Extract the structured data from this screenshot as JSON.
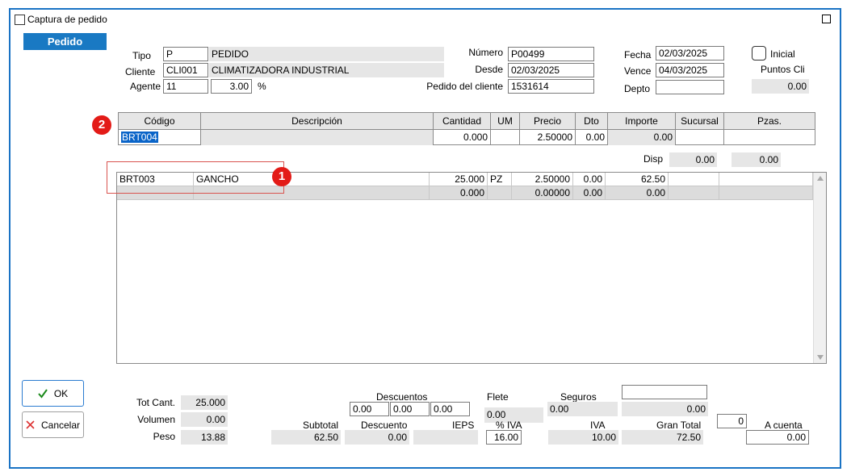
{
  "window": {
    "title": "Captura de pedido"
  },
  "tab": {
    "label": "Pedido"
  },
  "header": {
    "tipo_label": "Tipo",
    "tipo_code": "P",
    "tipo_desc": "PEDIDO",
    "cliente_label": "Cliente",
    "cliente_code": "CLI001",
    "cliente_name": "CLIMATIZADORA INDUSTRIAL",
    "agente_label": "Agente",
    "agente_code": "11",
    "agente_pct": "3.00",
    "pct_symbol": "%",
    "numero_label": "Número",
    "numero": "P00499",
    "desde_label": "Desde",
    "desde": "02/03/2025",
    "pedido_cliente_label": "Pedido del cliente",
    "pedido_cliente": "1531614",
    "fecha_label": "Fecha",
    "fecha": "02/03/2025",
    "vence_label": "Vence",
    "vence": "04/03/2025",
    "depto_label": "Depto",
    "depto": "",
    "inicial_label": "Inicial",
    "puntos_label": "Puntos Cli",
    "puntos": "0.00"
  },
  "entry_table": {
    "columns": [
      "Código",
      "Descripción",
      "Cantidad",
      "UM",
      "Precio",
      "Dto",
      "Importe",
      "Sucursal",
      "Pzas."
    ],
    "row": {
      "codigo": "BRT004",
      "descripcion": "",
      "cantidad": "0.000",
      "um": "",
      "precio": "2.50000",
      "dto": "0.00",
      "importe": "0.00",
      "sucursal": "",
      "pzas": ""
    }
  },
  "disp": {
    "label": "Disp",
    "value1": "0.00",
    "value2": "0.00"
  },
  "lines": [
    {
      "codigo": "BRT003",
      "descripcion": "GANCHO",
      "cantidad": "25.000",
      "um": "PZ",
      "precio": "2.50000",
      "dto": "0.00",
      "importe": "62.50",
      "sucursal": "",
      "pzas": ""
    },
    {
      "codigo": "",
      "descripcion": "",
      "cantidad": "0.000",
      "um": "",
      "precio": "0.00000",
      "dto": "0.00",
      "importe": "0.00",
      "sucursal": "",
      "pzas": ""
    }
  ],
  "annotations": {
    "badge1": "1",
    "badge2": "2"
  },
  "buttons": {
    "ok": "OK",
    "cancel": "Cancelar"
  },
  "totals": {
    "tot_cant_label": "Tot Cant.",
    "tot_cant": "25.000",
    "volumen_label": "Volumen",
    "volumen": "0.00",
    "peso_label": "Peso",
    "peso": "13.88",
    "descuentos_label": "Descuentos",
    "desc1": "0.00",
    "desc2": "0.00",
    "desc3": "0.00",
    "flete_label": "Flete",
    "flete": "0.00",
    "seguros_label": "Seguros",
    "seguros": "0.00",
    "extra_field": "",
    "extra_value": "0.00",
    "subtotal_label": "Subtotal",
    "subtotal": "62.50",
    "descuento_label": "Descuento",
    "descuento": "0.00",
    "ieps_label": "IEPS",
    "ieps": "",
    "pct_iva_label": "% IVA",
    "pct_iva": "16.00",
    "iva_label": "IVA",
    "iva": "10.00",
    "gran_total_label": "Gran Total",
    "gran_total": "72.50",
    "a_cuenta_count": "0",
    "a_cuenta_label": "A cuenta",
    "a_cuenta": "0.00"
  },
  "colors": {
    "accent": "#1979c3",
    "badge": "#e31b17",
    "readonly_bg": "#e6e6e6"
  }
}
